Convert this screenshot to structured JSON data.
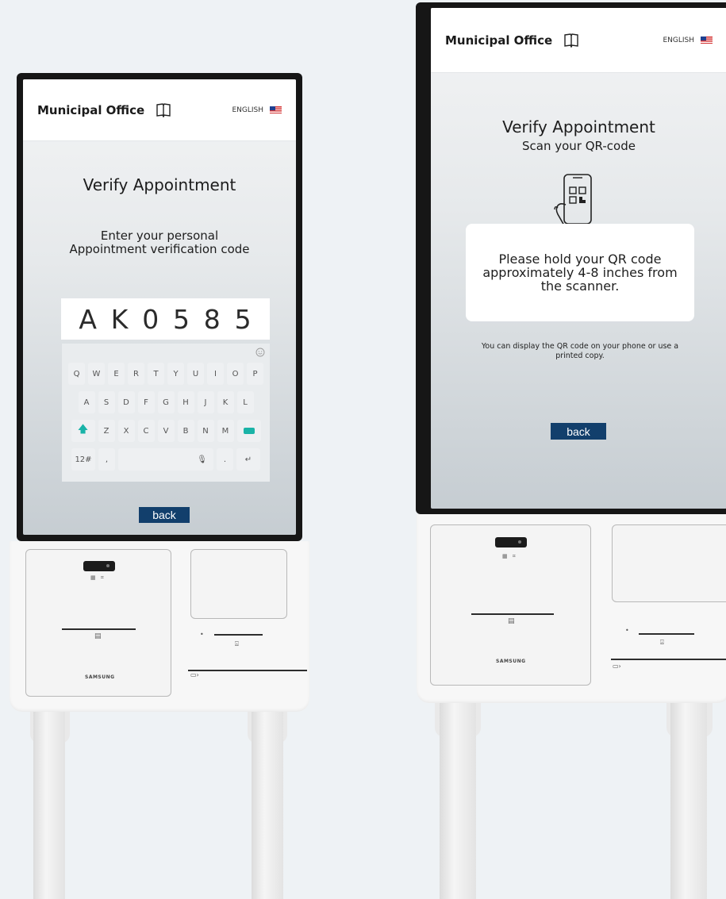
{
  "app": {
    "title": "Municipal Office",
    "language": "ENGLISH",
    "book_icon": "book-icon",
    "flag_icon": "us-flag-icon"
  },
  "colors": {
    "primary": "#123f6c",
    "accent": "#1ab3a7",
    "card": "#ffffff"
  },
  "kiosk_code": {
    "title": "Verify Appointment",
    "instruction_line1": "Enter your personal",
    "instruction_line2": "Appointment verification code",
    "code_chars": [
      "A",
      "K",
      "0",
      "5",
      "8",
      "5"
    ],
    "keyboard": {
      "row1": [
        "Q",
        "W",
        "E",
        "R",
        "T",
        "Y",
        "U",
        "I",
        "O",
        "P"
      ],
      "row2": [
        "A",
        "S",
        "D",
        "F",
        "G",
        "H",
        "J",
        "K",
        "L"
      ],
      "row3": [
        "Z",
        "X",
        "C",
        "V",
        "B",
        "N",
        "M"
      ],
      "symbols_key": "12#",
      "comma_key": ",",
      "period_key": ".",
      "enter_key": "↵",
      "shift_key": "🡅",
      "mic_glyph": "🎙"
    },
    "back_label": "back"
  },
  "kiosk_qr": {
    "title": "Verify Appointment",
    "subtitle": "Scan your QR-code",
    "hold_message": "Please hold your QR code approximately 4-8 inches from the scanner.",
    "hint": "You can display the QR code on your phone or use a printed copy.",
    "back_label": "back"
  },
  "hardware": {
    "brand": "SAMSUNG"
  }
}
